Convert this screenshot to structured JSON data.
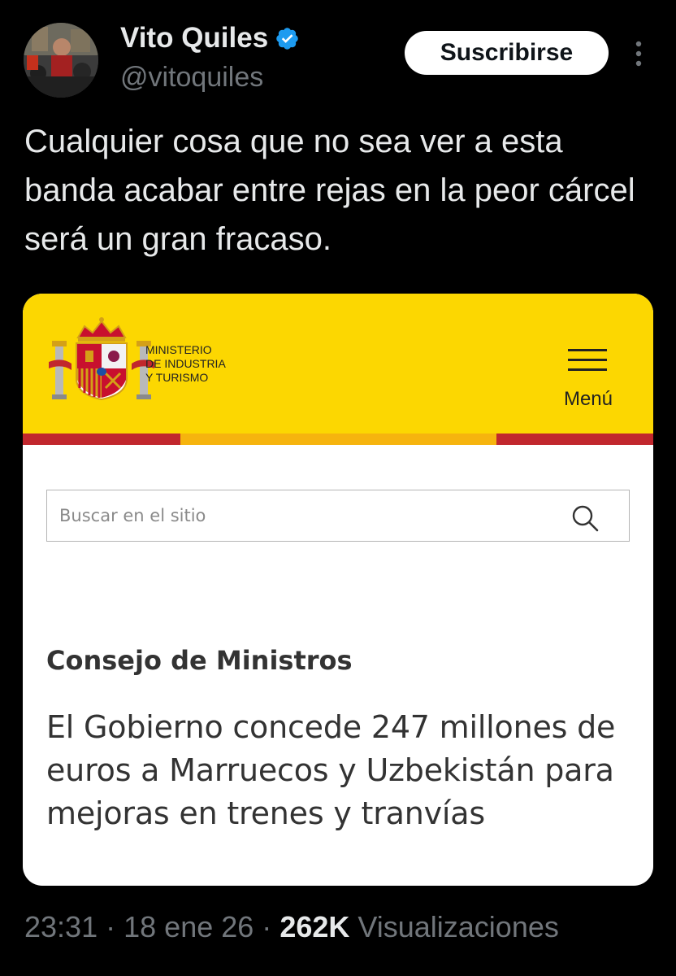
{
  "author": {
    "name": "Vito Quiles",
    "handle": "@vitoquiles",
    "verified_icon": "verified-badge-icon",
    "verified_color": "#1d9bf0"
  },
  "actions": {
    "subscribe_label": "Suscribirse",
    "more_icon": "more-vertical-icon"
  },
  "tweet": {
    "text": "Cualquier cosa que no sea ver a esta banda acabar entre rejas en la peor cárcel será un gran fracaso."
  },
  "embedded_page": {
    "ministry_name": "MINISTERIO\nDE INDUSTRIA\nY TURISMO",
    "menu_label": "Menú",
    "search_placeholder": "Buscar en el sitio",
    "section": "Consejo de Ministros",
    "headline": "El Gobierno concede 247 millones de euros a Marruecos y Uzbekistán para mejoras en trenes y tranvías",
    "colors": {
      "header_yellow": "#fcd701",
      "stripe_red": "#c1272d",
      "stripe_gold": "#f6b40e"
    }
  },
  "meta": {
    "time": "23:31",
    "date": "18 ene 26",
    "views_count": "262K",
    "views_label": "Visualizaciones",
    "separator": "·"
  }
}
